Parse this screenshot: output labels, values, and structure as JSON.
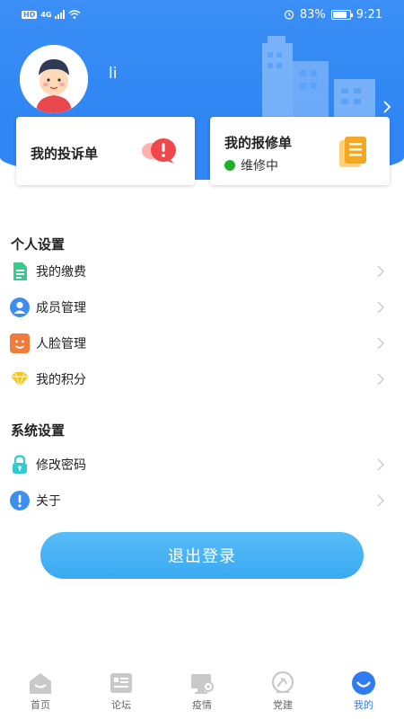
{
  "status_bar": {
    "network_badge": "HD",
    "network_type": "4G",
    "battery_percent": "83%",
    "battery_level": 0.83,
    "time": "9:21"
  },
  "profile": {
    "username": "li"
  },
  "cards": {
    "complaint": {
      "title": "我的投诉单"
    },
    "repair": {
      "title": "我的报修单",
      "status": "维修中",
      "status_color": "#1fb12a"
    }
  },
  "personal_settings": {
    "title": "个人设置",
    "items": [
      {
        "label": "我的缴费",
        "icon": "bill-icon",
        "color": "#3cc98f"
      },
      {
        "label": "成员管理",
        "icon": "user-icon",
        "color": "#3d8ef0"
      },
      {
        "label": "人脸管理",
        "icon": "face-icon",
        "color": "#f27a3a"
      },
      {
        "label": "我的积分",
        "icon": "diamond-icon",
        "color": "#f5c41a"
      }
    ]
  },
  "system_settings": {
    "title": "系统设置",
    "items": [
      {
        "label": "修改密码",
        "icon": "lock-icon",
        "color": "#31c9d6"
      },
      {
        "label": "关于",
        "icon": "info-icon",
        "color": "#3d8ef0"
      }
    ]
  },
  "logout_label": "退出登录",
  "bottom_nav": [
    {
      "label": "首页",
      "icon": "home-icon",
      "active": false
    },
    {
      "label": "论坛",
      "icon": "forum-icon",
      "active": false
    },
    {
      "label": "疫情",
      "icon": "epidemic-icon",
      "active": false
    },
    {
      "label": "党建",
      "icon": "party-building-icon",
      "active": false
    },
    {
      "label": "我的",
      "icon": "profile-icon",
      "active": true
    }
  ],
  "colors": {
    "header_blue": "#2f86f4",
    "accent_blue": "#3aa9f2",
    "nav_active": "#2f7cf0"
  }
}
